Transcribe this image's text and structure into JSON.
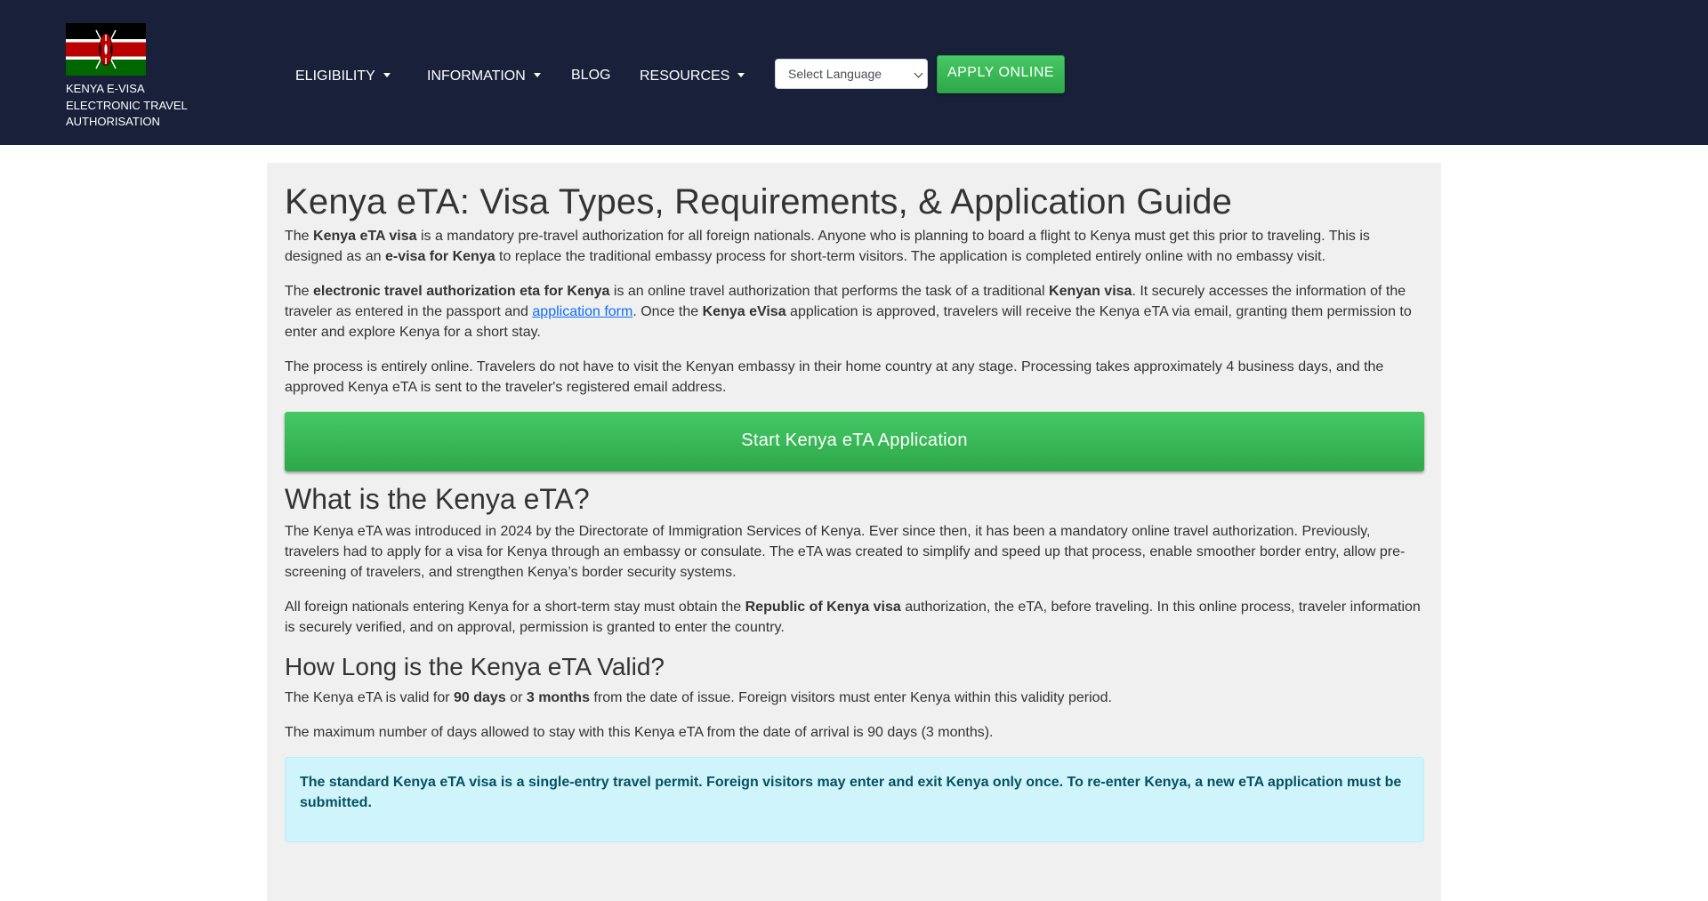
{
  "header": {
    "brand_text_1": "KENYA E-VISA",
    "brand_text_2": "ELECTRONIC TRAVEL",
    "brand_text_3": "AUTHORISATION",
    "nav": [
      {
        "label": "ELIGIBILITY",
        "dropdown": true
      },
      {
        "label": "INFORMATION",
        "dropdown": true
      },
      {
        "label": "BLOG",
        "dropdown": false
      },
      {
        "label": "RESOURCES",
        "dropdown": true
      }
    ],
    "language_select": "Select Language",
    "apply_button": "APPLY ONLINE"
  },
  "colors": {
    "nav_bg": "#19203a",
    "accent_green": "#3fc25a",
    "alert_bg": "#cff4fc",
    "alert_text": "#055160",
    "link": "#0d6efd"
  },
  "content": {
    "title": "Kenya eTA: Visa Types, Requirements, & Application Guide",
    "p1": {
      "a": "The ",
      "b1": "Kenya eTA visa",
      "c": " is a mandatory pre-travel authorization for all foreign nationals. Anyone who is planning to board a flight to Kenya must get this prior to traveling. This is designed as an ",
      "b2": "e-visa for Kenya",
      "d": " to replace the traditional embassy process for short-term visitors. The application is completed entirely online with no embassy visit."
    },
    "p2": {
      "a": "The ",
      "b1": "electronic travel authorization eta for Kenya",
      "c": " is an online travel authorization that performs the task of a traditional ",
      "b2": "Kenyan visa",
      "d": ". It securely accesses the information of the traveler as entered in the passport and ",
      "link": "application form",
      "e": ". Once the ",
      "b3": "Kenya eVisa",
      "f": " application is approved, travelers will receive the Kenya eTA via email, granting them permission to enter and explore Kenya for a short stay."
    },
    "p3": "The process is entirely online. Travelers do not have to visit the Kenyan embassy in their home country at any stage. Processing takes approximately 4 business days, and the approved Kenya eTA is sent to the traveler's registered email address.",
    "start_button": "Start Kenya eTA Application",
    "h2_what": "What is the Kenya eTA?",
    "p4": "The Kenya eTA was introduced in 2024 by the Directorate of Immigration Services of Kenya. Ever since then, it has been a mandatory online travel authorization. Previously, travelers had to apply for a visa for Kenya through an embassy or consulate. The eTA was created to simplify and speed up that process, enable smoother border entry, allow pre-screening of travelers, and strengthen Kenya’s border security systems.",
    "p5": {
      "a": "All foreign nationals entering Kenya for a short-term stay must obtain the ",
      "b1": "Republic of Kenya visa",
      "c": " authorization, the eTA, before traveling. In this online process, traveler information is securely verified, and on approval, permission is granted to enter the country."
    },
    "h3_valid": "How Long is the Kenya eTA Valid?",
    "p6": {
      "a": "The Kenya eTA is valid for ",
      "b1": "90 days",
      "c": " or ",
      "b2": "3 months",
      "d": " from the date of issue. Foreign visitors must enter Kenya within this validity period."
    },
    "p7": "The maximum number of days allowed to stay with this Kenya eTA from the date of arrival is 90 days (3 months).",
    "alert": "The standard Kenya eTA visa is a single-entry travel permit. Foreign visitors may enter and exit Kenya only once. To re-enter Kenya, a new eTA application must be submitted."
  }
}
